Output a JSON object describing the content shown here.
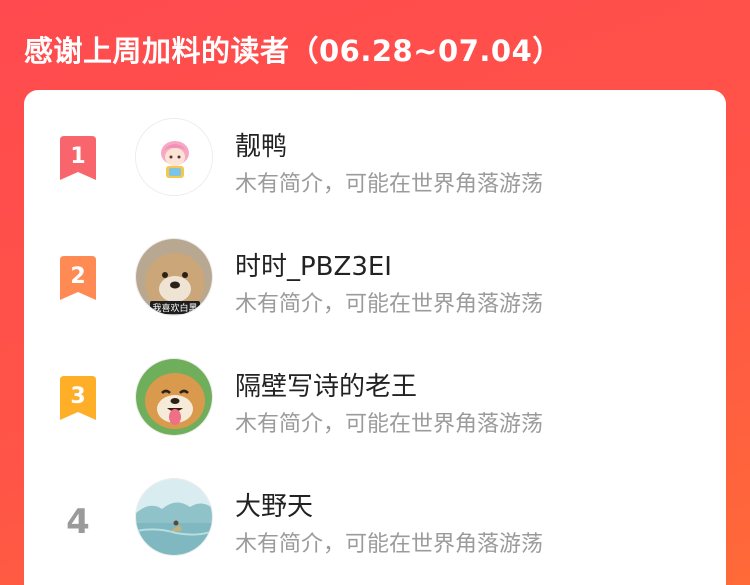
{
  "header": {
    "title": "感谢上周加料的读者（06.28~07.04）"
  },
  "colors": {
    "background": "#ff4d4f",
    "rank1": "#f8656d",
    "rank2": "#ff8a54",
    "rank3": "#ffae27",
    "rank_plain": "#9a9a9a"
  },
  "readers": [
    {
      "rank": "1",
      "name": "靓鸭",
      "bio": "木有简介，可能在世界角落游荡",
      "avatar_icon": "pink-hair-girl-avatar"
    },
    {
      "rank": "2",
      "name": "时时_PBZ3EI",
      "bio": "木有简介，可能在世界角落游荡",
      "avatar_icon": "shiba-dog-avatar",
      "avatar_caption": "我喜欢白黑"
    },
    {
      "rank": "3",
      "name": "隔壁写诗的老王",
      "bio": "木有简介，可能在世界角落游荡",
      "avatar_icon": "smiling-shiba-avatar"
    },
    {
      "rank": "4",
      "name": "大野天",
      "bio": "木有简介，可能在世界角落游荡",
      "avatar_icon": "landscape-painting-avatar"
    }
  ]
}
